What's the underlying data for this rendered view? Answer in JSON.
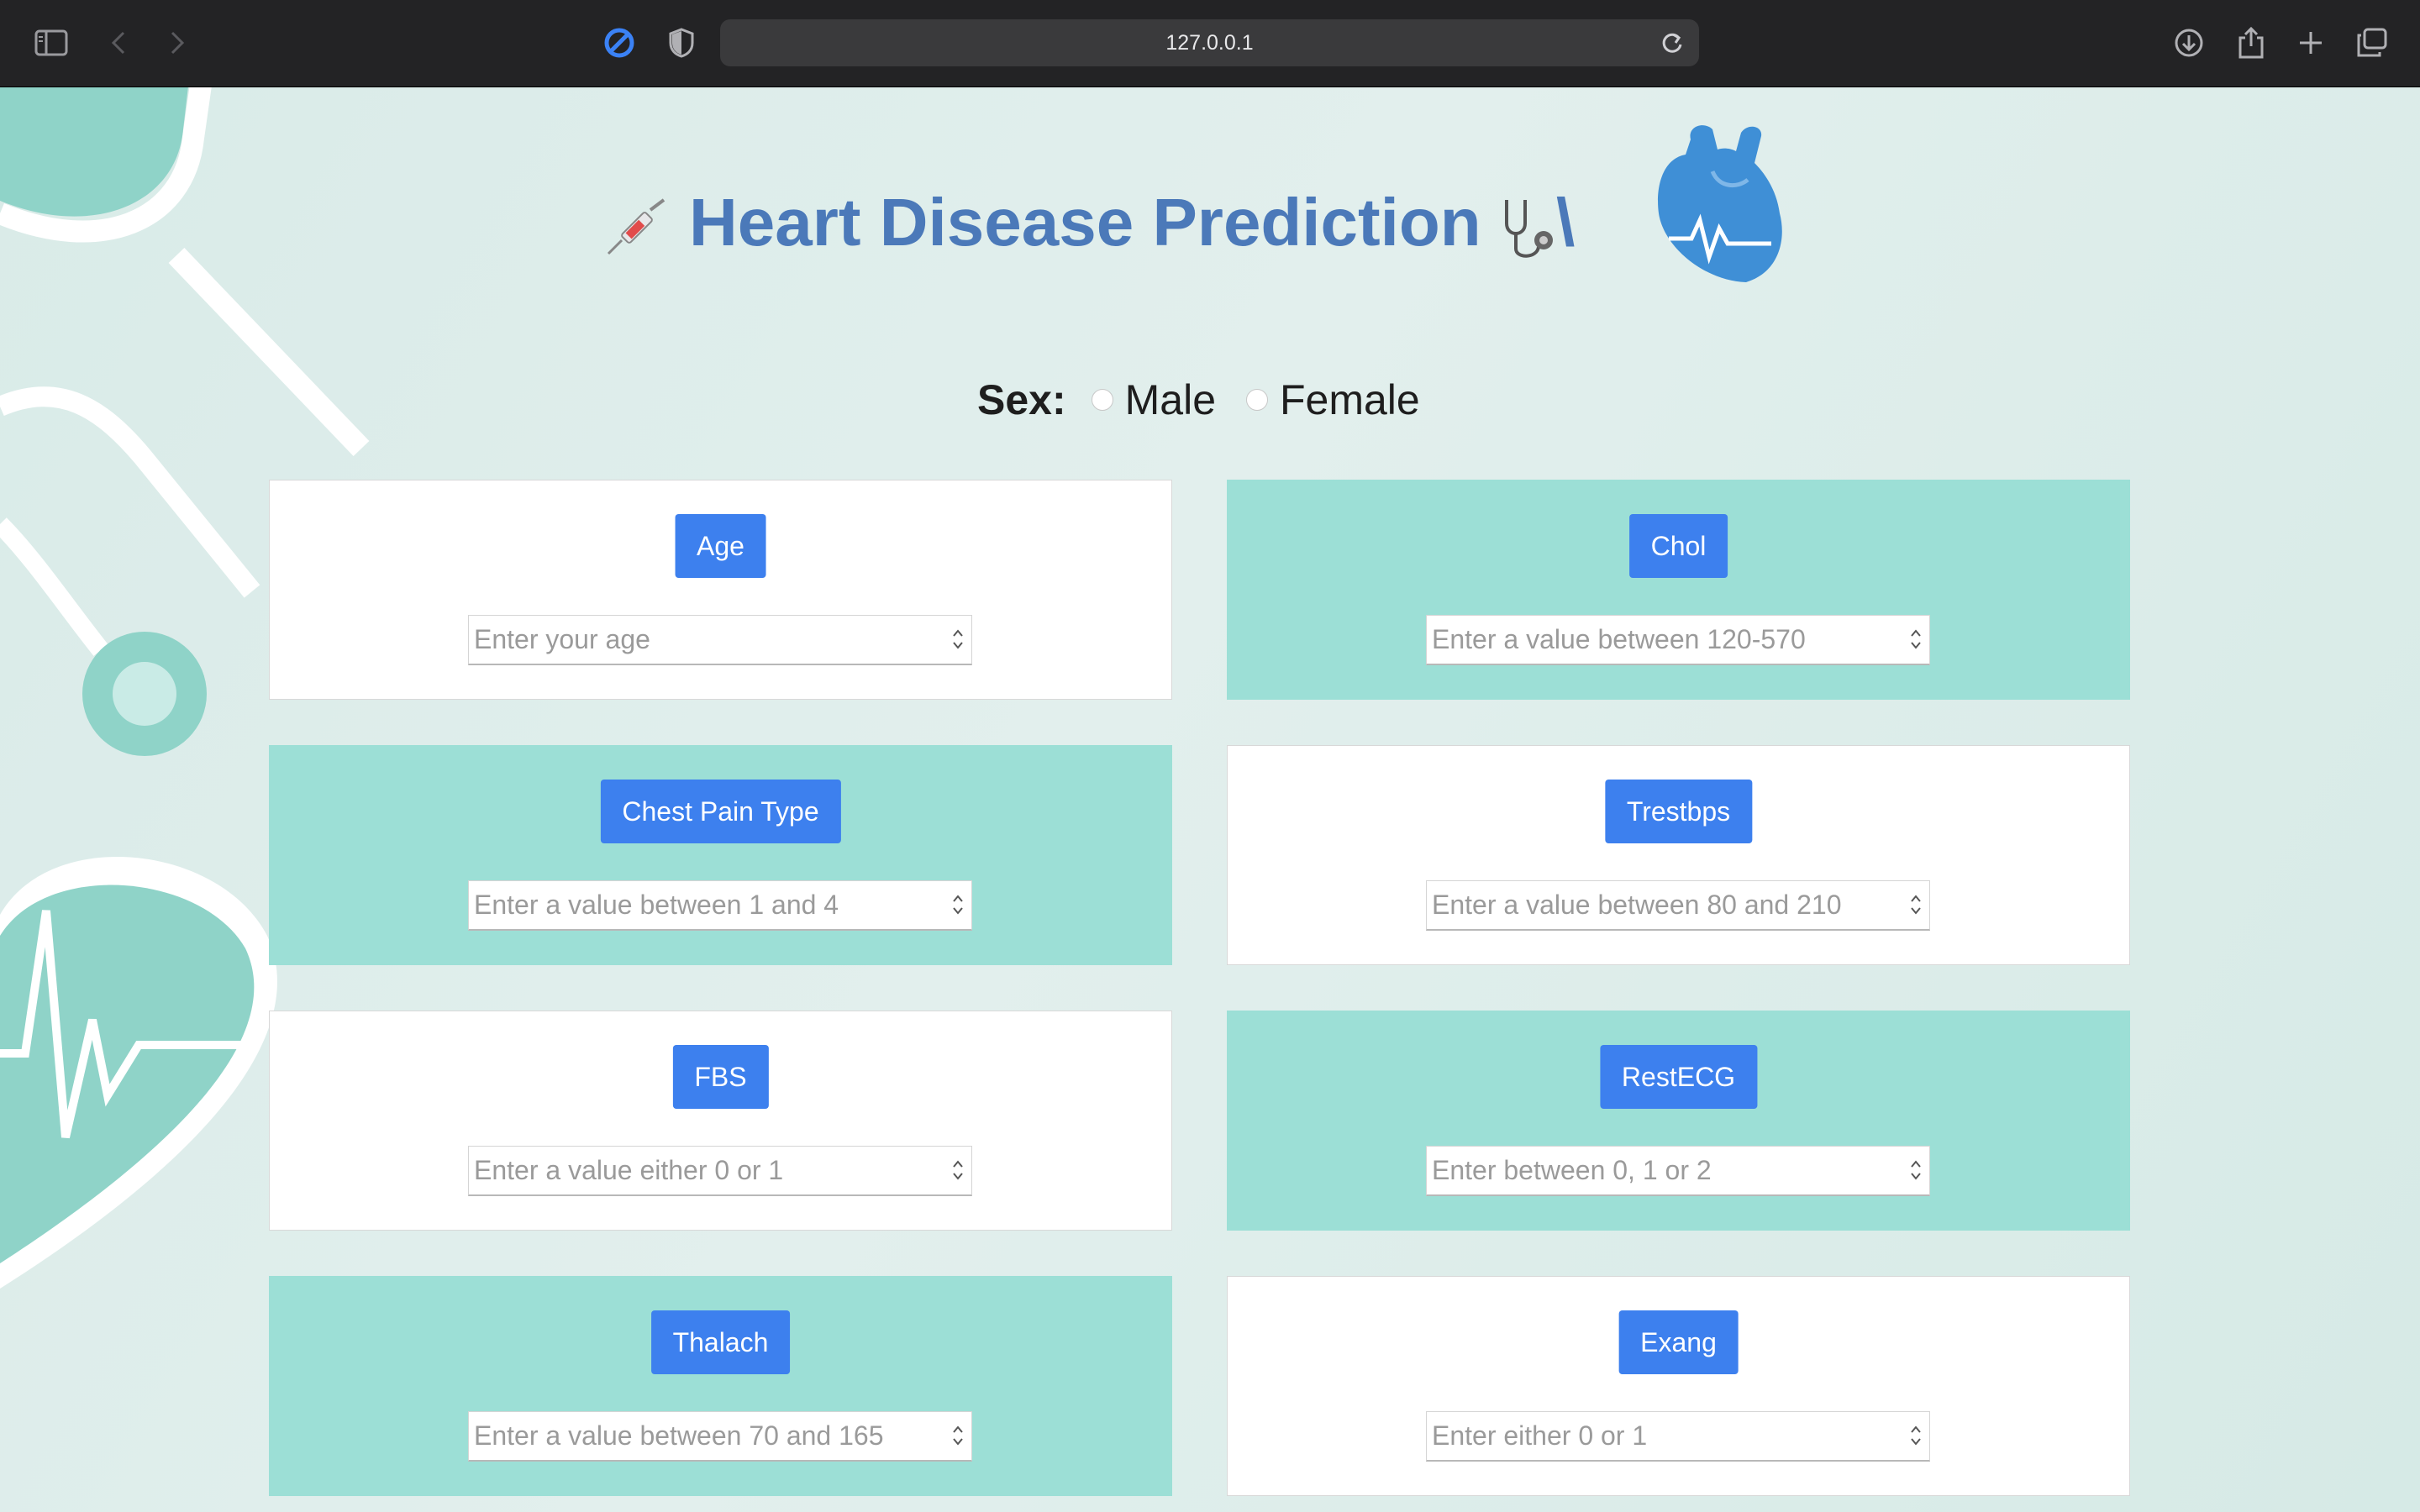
{
  "browser": {
    "url": "127.0.0.1"
  },
  "header": {
    "title": "Heart Disease Prediction",
    "trailing_mark": "\\"
  },
  "sex": {
    "label": "Sex:",
    "options": [
      "Male",
      "Female"
    ]
  },
  "fields": [
    {
      "label": "Age",
      "placeholder": "Enter your age",
      "style": "white"
    },
    {
      "label": "Chol",
      "placeholder": "Enter a value between 120-570",
      "style": "teal"
    },
    {
      "label": "Chest Pain Type",
      "placeholder": "Enter a value between 1 and 4",
      "style": "teal"
    },
    {
      "label": "Trestbps",
      "placeholder": "Enter a value between 80 and 210",
      "style": "white"
    },
    {
      "label": "FBS",
      "placeholder": "Enter a value either 0 or 1",
      "style": "white"
    },
    {
      "label": "RestECG",
      "placeholder": "Enter between 0, 1 or 2",
      "style": "teal"
    },
    {
      "label": "Thalach",
      "placeholder": "Enter a value between 70 and 165",
      "style": "teal"
    },
    {
      "label": "Exang",
      "placeholder": "Enter either 0 or 1",
      "style": "white"
    }
  ],
  "colors": {
    "title": "#4b79b9",
    "button": "#3d80ee",
    "teal_card": "#9cdfd6",
    "accent_decor": "#8fd3c8"
  }
}
